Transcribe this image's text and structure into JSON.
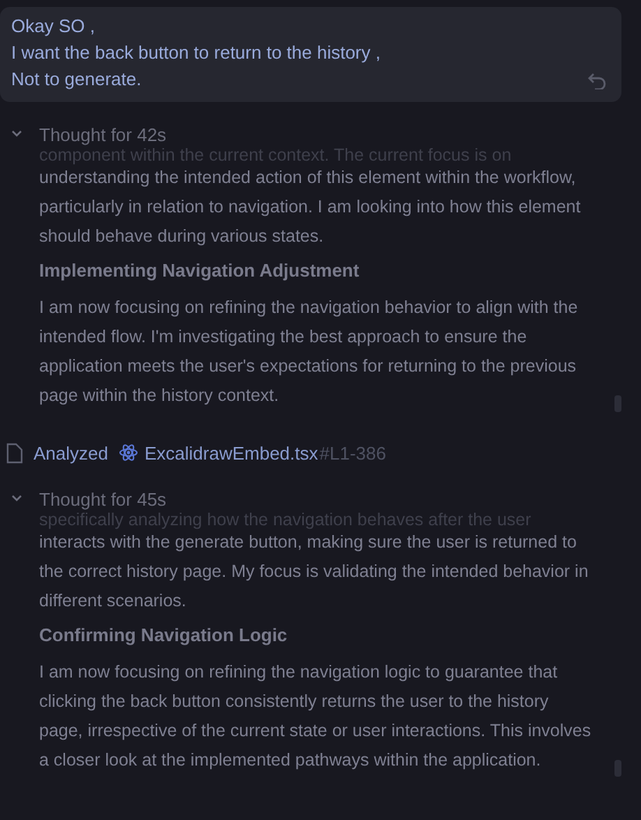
{
  "user_message": {
    "lines": [
      "Okay SO ,",
      "I want the back button to return to the history ,",
      "Not to generate."
    ]
  },
  "items": [
    {
      "kind": "thought",
      "title": "Thought for 42s",
      "expanded": true,
      "faded_line": "component within the current context. The current focus is on",
      "blocks": [
        {
          "kind": "paragraph",
          "lines": [
            "understanding the intended action of this element within the workflow,",
            "particularly in relation to navigation. I am looking into how this element",
            "should behave during various states."
          ]
        },
        {
          "kind": "heading",
          "text": "Implementing Navigation Adjustment"
        },
        {
          "kind": "paragraph",
          "lines": [
            "I am now focusing on refining the navigation behavior to align with the",
            "intended flow. I'm investigating the best approach to ensure the",
            "application meets the user's expectations for returning to the previous",
            "page within the history context."
          ]
        }
      ]
    },
    {
      "kind": "file",
      "action": "Analyzed",
      "file": "ExcalidrawEmbed.tsx",
      "range": "#L1-386"
    },
    {
      "kind": "thought",
      "title": "Thought for 45s",
      "expanded": true,
      "faded_line": "specifically analyzing how the navigation behaves after the user",
      "blocks": [
        {
          "kind": "paragraph",
          "lines": [
            "interacts with the generate button, making sure the user is returned to",
            "the correct history page. My focus is validating the intended behavior in",
            "different scenarios."
          ]
        },
        {
          "kind": "heading",
          "text": "Confirming Navigation Logic"
        },
        {
          "kind": "paragraph",
          "lines": [
            "I am now focusing on refining the navigation logic to guarantee that",
            "clicking the back button consistently returns the user to the history",
            "page, irrespective of the current state or user interactions. This involves",
            "a closer look at the implemented pathways within the application."
          ]
        }
      ]
    }
  ]
}
